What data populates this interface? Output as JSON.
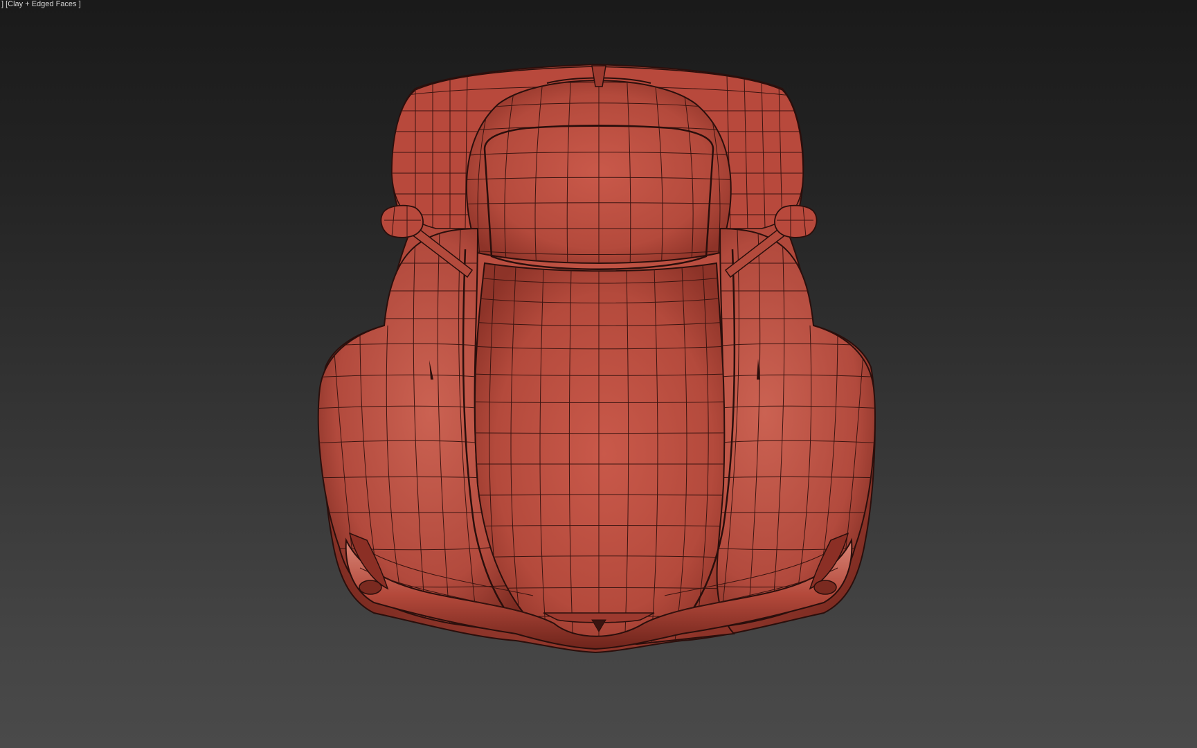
{
  "viewport": {
    "label": "] [Clay + Edged Faces ]",
    "shading_mode": "Clay + Edged Faces",
    "background_top": "#1a1a1a",
    "background_bottom": "#4a4a4a"
  },
  "model": {
    "name": "sports-car",
    "view": "front-top",
    "clay_color": "#c0503f",
    "clay_highlight": "#d0705d",
    "clay_shadow": "#6a2018",
    "edge_color": "#2a0f0c"
  }
}
